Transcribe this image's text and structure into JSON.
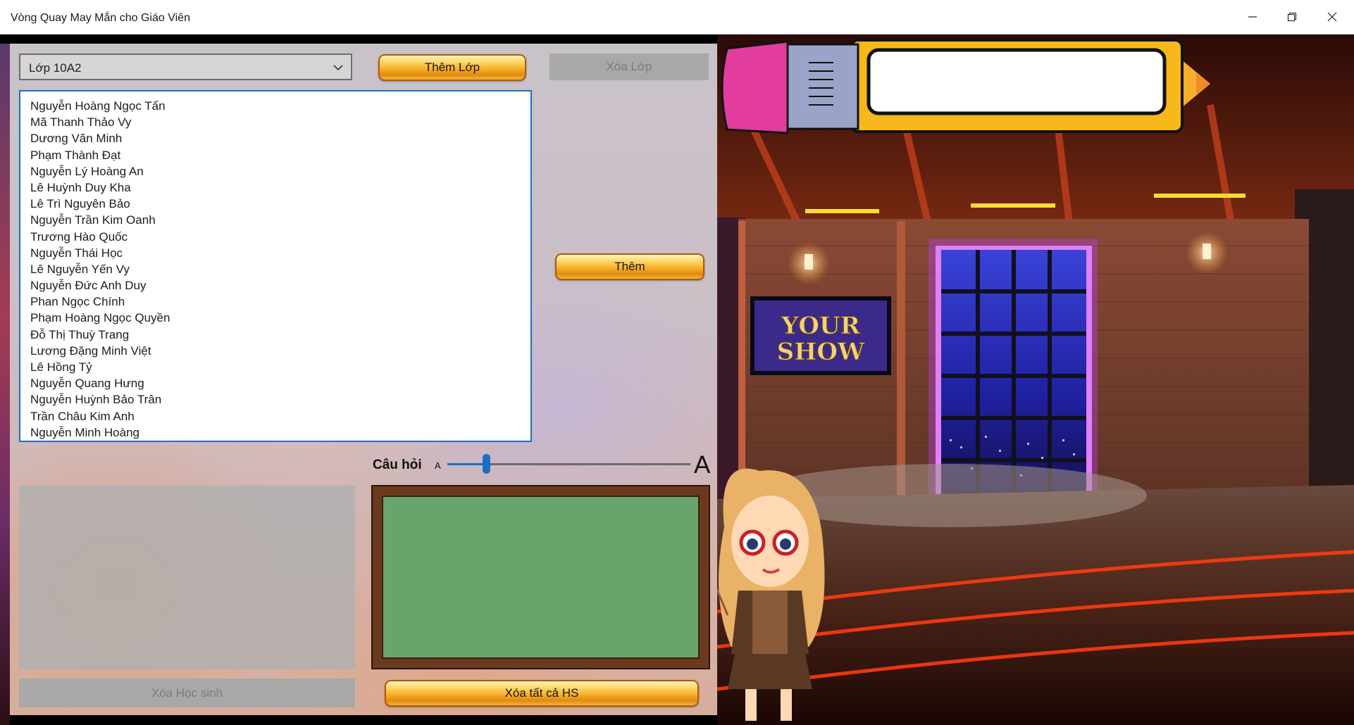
{
  "window": {
    "title": "Vòng Quay May Mắn cho Giáo Viên",
    "icons": [
      "minimize-icon",
      "restore-icon",
      "close-icon"
    ]
  },
  "class_selector": {
    "selected": "Lớp 10A2"
  },
  "buttons": {
    "add_class": "Thêm Lớp",
    "delete_class": "Xóa Lớp",
    "add": "Thêm",
    "delete_student": "Xóa Học sinh",
    "delete_all": "Xóa tất cả HS"
  },
  "students": [
    "Nguyễn Hoàng Ngọc Tấn",
    "Mã Thanh Thảo Vy",
    "Dương Văn Minh",
    "Phạm Thành Đạt",
    "Nguyễn Lý Hoàng An",
    "Lê Huỳnh Duy Kha",
    "Lê Trì Nguyên Bảo",
    "Nguyễn Trần Kim Oanh",
    "Trương Hào Quốc",
    "Nguyễn Thái Học",
    "Lê Nguyễn Yến Vy",
    "Nguyễn Đức Anh Duy",
    "Phan Ngọc Chính",
    "Phạm Hoàng Ngọc Quyền",
    "Đỗ Thị Thuỳ Trang",
    "Lương Đặng Minh Việt",
    "Lê Hồng Tỷ",
    "Nguyễn Quang Hưng",
    "Nguyễn Huỳnh Bảo Trân",
    "Trần Châu Kim Anh",
    "Nguyễn Minh Hoàng"
  ],
  "question": {
    "label": "Câu hỏi",
    "size_small_glyph": "A",
    "size_large_glyph": "A",
    "font_size_slider_fraction": 0.16
  },
  "stage": {
    "sign_line1": "YOUR",
    "sign_line2": "SHOW"
  },
  "colors": {
    "accent": "#1a6fc4",
    "gold": "#f7b02a",
    "chalkboard": "#68a56c"
  }
}
